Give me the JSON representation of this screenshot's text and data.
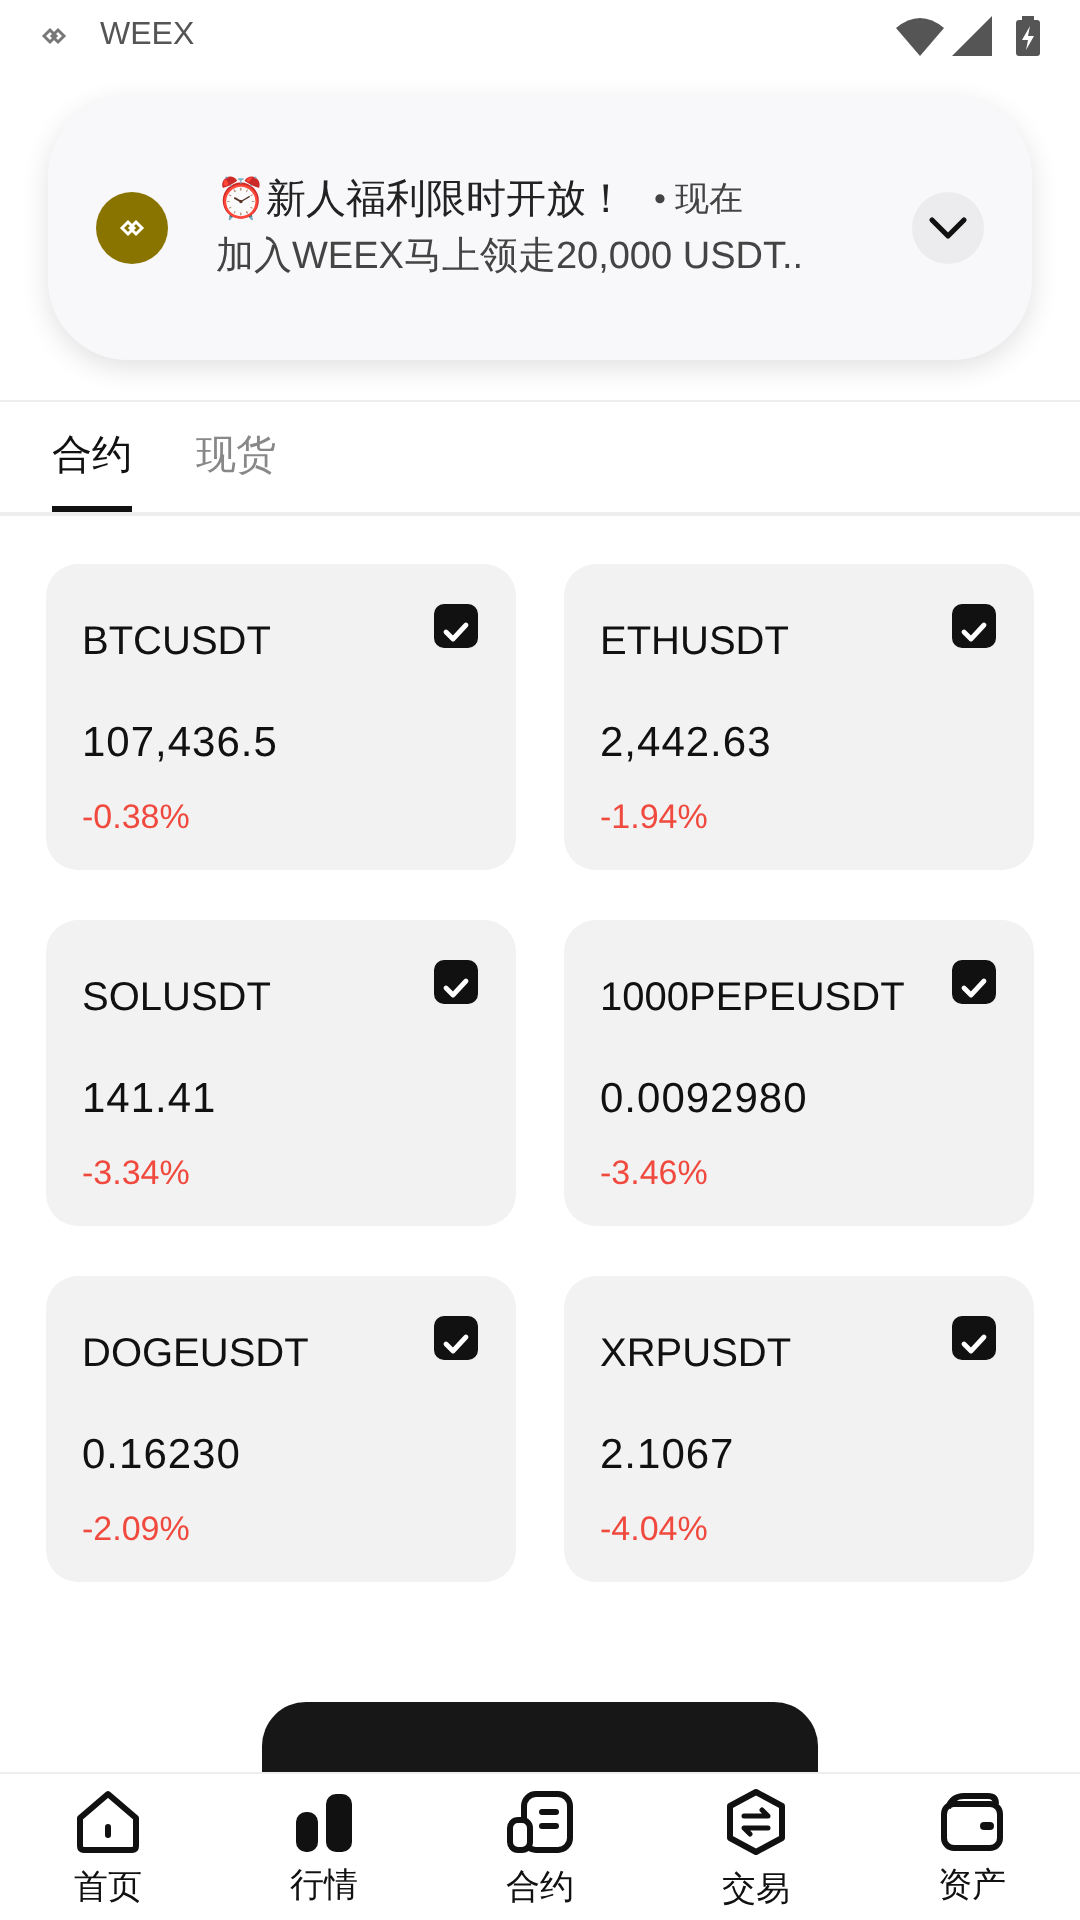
{
  "status_bar": {
    "app": "WEEX"
  },
  "notification": {
    "title": "⏰新人福利限时开放！",
    "time": "• 现在",
    "body": "加入WEEX马上领走20,000 USDT.."
  },
  "tabs": [
    {
      "label": "合约",
      "selected": true
    },
    {
      "label": "现货",
      "selected": false
    }
  ],
  "cards": [
    {
      "symbol": "BTCUSDT",
      "price": "107,436.5",
      "change": "-0.38%",
      "checked": true
    },
    {
      "symbol": "ETHUSDT",
      "price": "2,442.63",
      "change": "-1.94%",
      "checked": true
    },
    {
      "symbol": "SOLUSDT",
      "price": "141.41",
      "change": "-3.34%",
      "checked": true
    },
    {
      "symbol": "1000PEPEUSDT",
      "price": "0.0092980",
      "change": "-3.46%",
      "checked": true
    },
    {
      "symbol": "DOGEUSDT",
      "price": "0.16230",
      "change": "-2.09%",
      "checked": true
    },
    {
      "symbol": "XRPUSDT",
      "price": "2.1067",
      "change": "-4.04%",
      "checked": true
    }
  ],
  "bottom_nav": [
    {
      "label": "首页"
    },
    {
      "label": "行情"
    },
    {
      "label": "合约"
    },
    {
      "label": "交易"
    },
    {
      "label": "资产"
    }
  ]
}
